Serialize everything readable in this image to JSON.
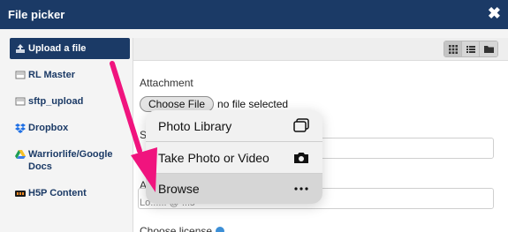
{
  "window": {
    "title": "File picker",
    "close_icon": "close-icon"
  },
  "sidebar": {
    "items": [
      {
        "label": "Upload a file",
        "icon": "upload-icon",
        "active": true
      },
      {
        "label": "RL Master",
        "icon": "server-icon"
      },
      {
        "label": "sftp_upload",
        "icon": "server-icon"
      },
      {
        "label": "Dropbox",
        "icon": "dropbox-icon"
      },
      {
        "label": "Warriorlife/Google Docs",
        "icon": "google-drive-icon"
      },
      {
        "label": "H5P Content",
        "icon": "h5p-icon"
      }
    ]
  },
  "viewbar": {
    "buttons": [
      "grid-view-icon",
      "list-view-icon",
      "folder-view-icon"
    ]
  },
  "form": {
    "attachment_label": "Attachment",
    "choose_button": "Choose File",
    "no_file_text": "no file selected",
    "save_as_label": "Sa",
    "author_label": "Au",
    "author_value": "Lo...... @ ...s",
    "license_label": "Choose license"
  },
  "popup": {
    "items": [
      {
        "label": "Photo Library",
        "icon": "photo-library-icon"
      },
      {
        "label": "Take Photo or Video",
        "icon": "camera-icon"
      },
      {
        "label": "Browse",
        "icon": "more-icon",
        "highlighted": true
      }
    ]
  },
  "colors": {
    "header": "#1b3a66",
    "annotation_arrow": "#f0147e",
    "help": "#3d8fd6"
  }
}
